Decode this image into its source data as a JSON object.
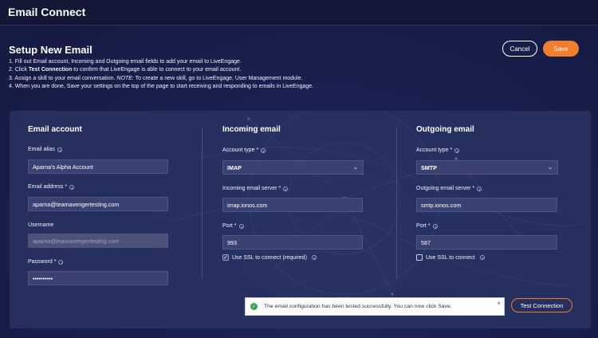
{
  "app": {
    "title": "Email Connect"
  },
  "page": {
    "title": "Setup New Email",
    "instructions": {
      "line1": "1. Fill out Email account, Incoming and Outgoing email fields to add your email to LiveEngage.",
      "line2_prefix": "2. Click ",
      "line2_bold": "Test Connection",
      "line2_suffix": " to confirm that LiveEngage is able to connect to your email account.",
      "line3_prefix": "3. Assign a skill to your email conversation. ",
      "line3_italic": "NOTE:",
      "line3_suffix": " To create a new skill, go to LiveEngage, User Management module.",
      "line4": "4. When you are done, Save your settings on the top of the page to start receiving and responding to emails in LiveEngage."
    }
  },
  "actions": {
    "cancel_label": "Cancel",
    "save_label": "Save",
    "test_connection_label": "Test Connection"
  },
  "email_account": {
    "title": "Email account",
    "alias_label": "Email alias",
    "alias_value": "Aparna's Alpha Account",
    "address_label": "Email address",
    "address_value": "aparna@teamavengertesting.com",
    "username_label": "Username",
    "username_placeholder": "aparna@teamavengertesting.com",
    "password_label": "Password",
    "password_value": "••••••••••"
  },
  "incoming": {
    "title": "Incoming email",
    "account_type_label": "Account type",
    "account_type_value": "IMAP",
    "server_label": "Incoming email server",
    "server_value": "imap.ionos.com",
    "port_label": "Port",
    "port_value": "993",
    "ssl_label": "Use SSL to connect (required)",
    "ssl_checked": true
  },
  "outgoing": {
    "title": "Outgoing email",
    "account_type_label": "Account type",
    "account_type_value": "SMTP",
    "server_label": "Outgoing email server",
    "server_value": "smtp.ionos.com",
    "port_label": "Port",
    "port_value": "587",
    "ssl_label": "Use SSL to connect",
    "ssl_checked": false
  },
  "required_marker": "*",
  "toast": {
    "message": "The email configuration has been tested successfully. You can now click Save.",
    "close_symbol": "×",
    "status_icon": "check-circle-icon"
  },
  "icons": {
    "info": "info-icon",
    "dropdown": "chevron-down-icon",
    "checkmark": "✓",
    "check": "✓"
  },
  "colors": {
    "accent": "#f07e2e",
    "success": "#3aa453",
    "background": "#1a2150"
  }
}
